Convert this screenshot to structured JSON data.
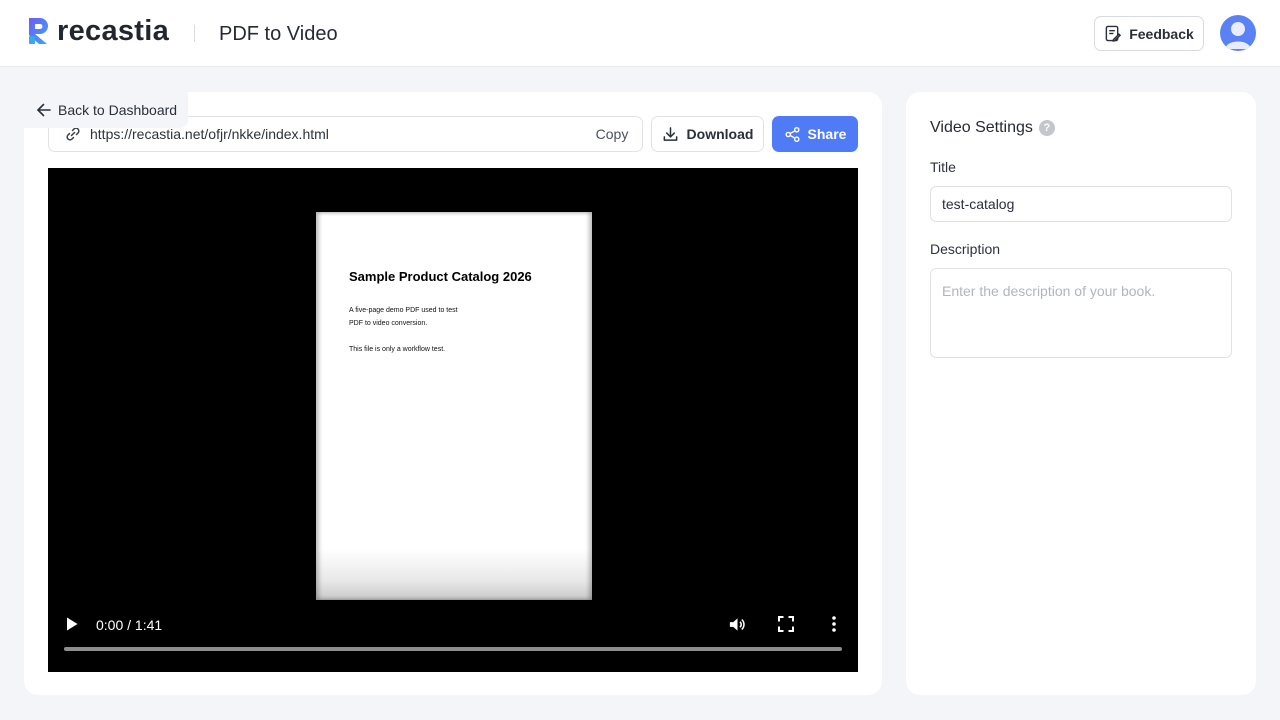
{
  "header": {
    "logo_text": "recastia",
    "page_title": "PDF to Video",
    "feedback_label": "Feedback",
    "brand_color": "#4f7bf7"
  },
  "toolbar": {
    "back_label": "Back to Dashboard",
    "url": "https://recastia.net/ofjr/nkke/index.html",
    "copy_label": "Copy",
    "download_label": "Download",
    "share_label": "Share"
  },
  "video": {
    "current_time": "0:00",
    "duration": "1:41",
    "time_display": "0:00 / 1:41",
    "progress": 0,
    "pdf_page": {
      "title": "Sample Product Catalog 2026",
      "line1": "A five-page demo PDF used to test",
      "line2": "PDF to video conversion.",
      "line3": "This file is only a workflow test."
    }
  },
  "settings": {
    "heading": "Video Settings",
    "help_glyph": "?",
    "title_label": "Title",
    "title_value": "test-catalog",
    "description_label": "Description",
    "description_placeholder": "Enter the description of your book.",
    "description_value": ""
  }
}
